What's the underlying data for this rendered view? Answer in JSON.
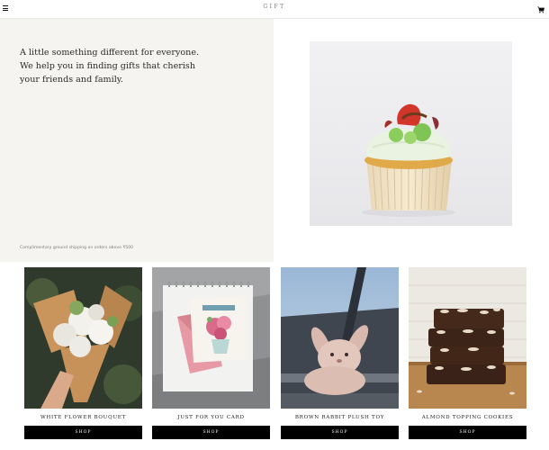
{
  "header": {
    "brand": "GIFT",
    "menu_icon": "menu-icon",
    "cart_icon": "cart-icon"
  },
  "hero": {
    "tagline_lines": [
      "A little something different for everyone.",
      "We help you in finding gifts that cherish",
      "your friends and family."
    ],
    "shipping_note": "Complimentary ground shipping on orders above ₹500",
    "image": "cupcake-image"
  },
  "products": [
    {
      "name": "WHITE FLOWER BOUQUET",
      "button": "SHOP",
      "image": "white-flower-bouquet-image"
    },
    {
      "name": "JUST FOR YOU CARD",
      "button": "SHOP",
      "image": "just-for-you-card-image"
    },
    {
      "name": "BROWN RABBIT PLUSH TOY",
      "button": "SHOP",
      "image": "brown-rabbit-plush-image"
    },
    {
      "name": "ALMOND TOPPING COOKIES",
      "button": "SHOP",
      "image": "almond-cookies-image"
    }
  ],
  "colors": {
    "hero_panel": "#f5f4f0",
    "button_bg": "#000000",
    "button_text": "#ffffff"
  }
}
